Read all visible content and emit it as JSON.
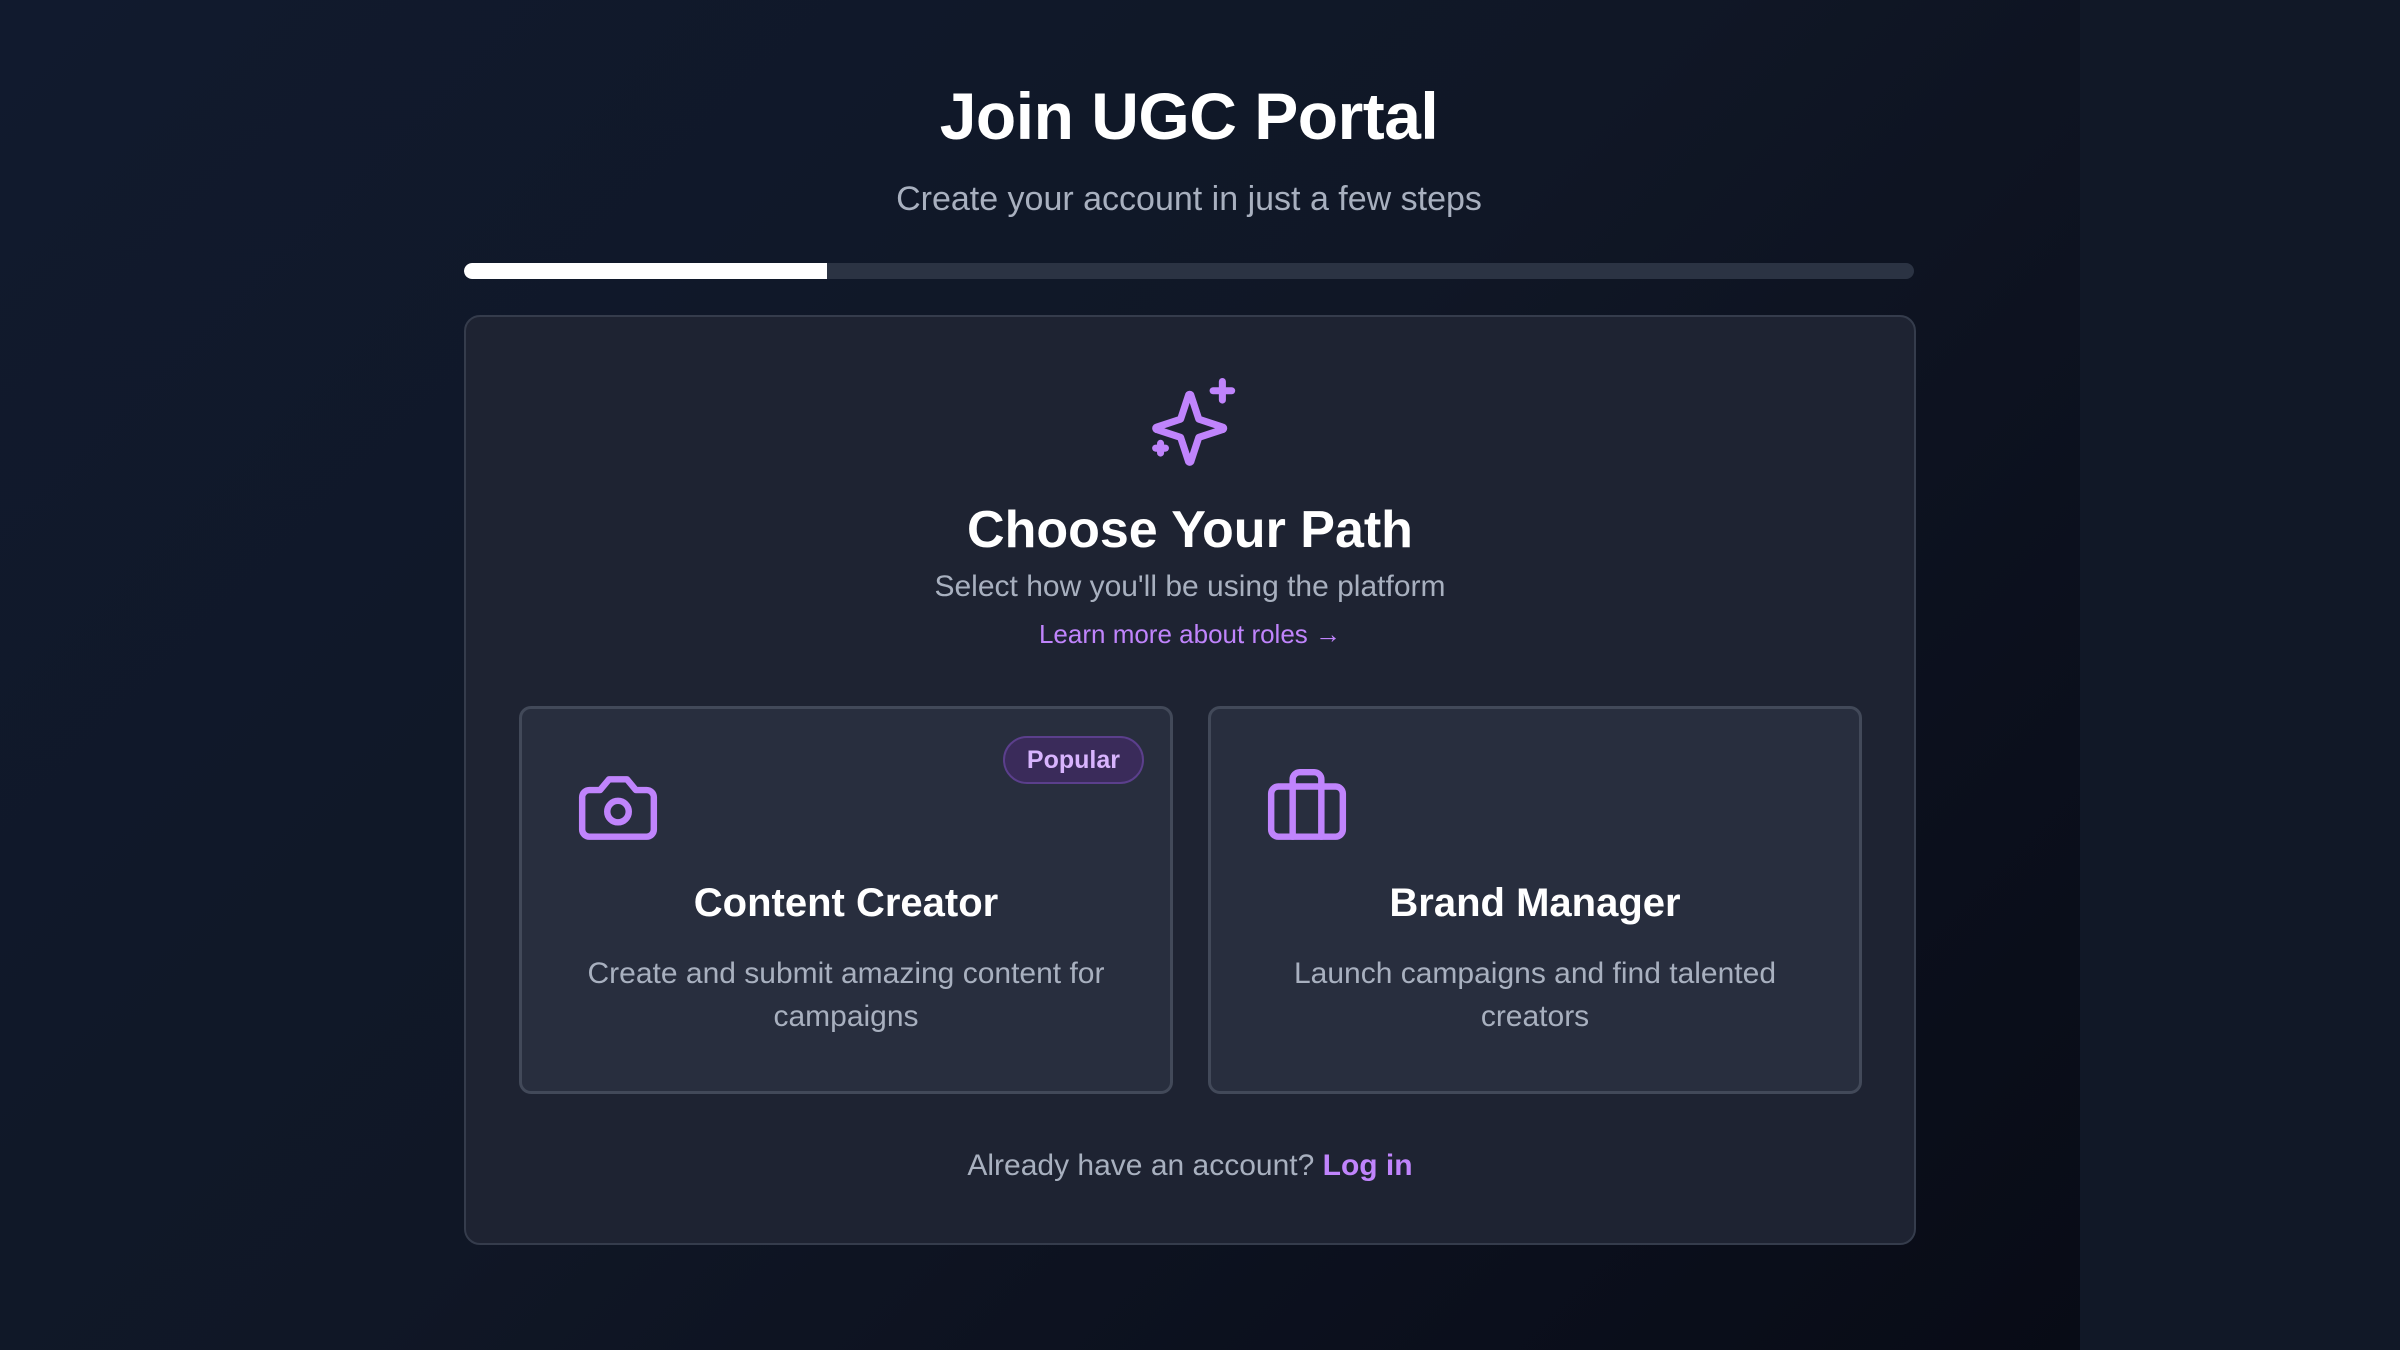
{
  "header": {
    "title": "Join UGC Portal",
    "subtitle": "Create your account in just a few steps"
  },
  "progress": {
    "fraction": 0.25
  },
  "step": {
    "icon": "sparkles-icon",
    "title": "Choose Your Path",
    "subtitle": "Select how you'll be using the platform",
    "learn_more": "Learn more about roles →"
  },
  "roles": [
    {
      "icon": "camera-icon",
      "badge": "Popular",
      "title": "Content Creator",
      "description": "Create and submit amazing content for campaigns"
    },
    {
      "icon": "briefcase-icon",
      "title": "Brand Manager",
      "description": "Launch campaigns and find talented creators"
    }
  ],
  "footer": {
    "prompt": "Already have an account?",
    "login_label": "Log in"
  },
  "colors": {
    "background": "#111827",
    "card": "#1e2332",
    "accent": "#c084fc",
    "progress_fill": "#ffffff"
  }
}
